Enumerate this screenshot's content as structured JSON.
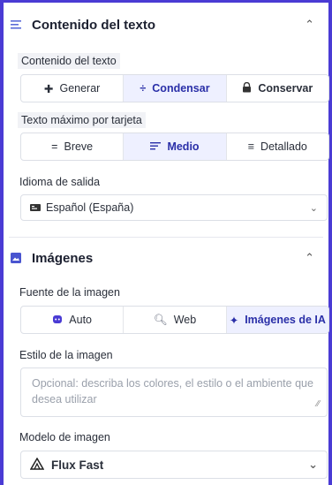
{
  "text_section": {
    "title": "Contenido del texto",
    "content_label": "Contenido del texto",
    "content_options": [
      {
        "label": "Generar",
        "icon": "plus-icon"
      },
      {
        "label": "Condensar",
        "icon": "divide-icon"
      },
      {
        "label": "Conservar",
        "icon": "lock-icon"
      }
    ],
    "content_selected": "Condensar",
    "max_text_label": "Texto máximo por tarjeta",
    "max_text_options": [
      {
        "label": "Breve",
        "icon": "lines-short-icon"
      },
      {
        "label": "Medio",
        "icon": "lines-medium-icon"
      },
      {
        "label": "Detallado",
        "icon": "lines-detailed-icon"
      }
    ],
    "max_text_selected": "Medio",
    "language_label": "Idioma de salida",
    "language_value": "Español (España)"
  },
  "images_section": {
    "title": "Imágenes",
    "source_label": "Fuente de la imagen",
    "source_options": [
      {
        "label": "Auto",
        "icon": "robot-icon"
      },
      {
        "label": "Web",
        "icon": "search-icon"
      },
      {
        "label": "Imágenes de IA",
        "icon": "sparkle-icon"
      }
    ],
    "source_selected": "Imágenes de IA",
    "style_label": "Estilo de la imagen",
    "style_placeholder": "Opcional: describa los colores, el estilo o el ambiente que desea utilizar",
    "model_label": "Modelo de imagen",
    "model_value": "Flux Fast"
  },
  "colors": {
    "accent": "#4a3bd4",
    "active_bg": "#eef0ff"
  }
}
